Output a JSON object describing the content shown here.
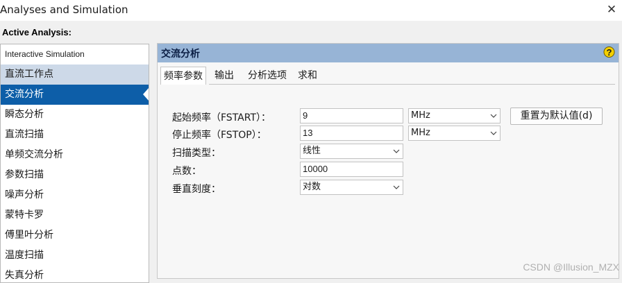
{
  "window": {
    "title": "Analyses and Simulation"
  },
  "active_analysis_label": "Active Analysis:",
  "analysis_list": [
    "Interactive Simulation",
    "直流工作点",
    "交流分析",
    "瞬态分析",
    "直流扫描",
    "单频交流分析",
    "参数扫描",
    "噪声分析",
    "蒙特卡罗",
    "傅里叶分析",
    "温度扫描",
    "失真分析"
  ],
  "selected_analysis": "交流分析",
  "panel": {
    "title": "交流分析",
    "tabs": [
      "频率参数",
      "输出",
      "分析选项",
      "求和"
    ],
    "active_tab": "频率参数"
  },
  "params": {
    "fstart": {
      "label": "起始频率（FSTART）：",
      "value": "9",
      "unit": "MHz"
    },
    "fstop": {
      "label": "停止频率（FSTOP）：",
      "value": "13",
      "unit": "MHz"
    },
    "sweep_type": {
      "label": "扫描类型：",
      "value": "线性"
    },
    "points": {
      "label": "点数：",
      "value": "10000"
    },
    "vertical_scale": {
      "label": "垂直刻度：",
      "value": "对数"
    }
  },
  "reset_button": "重置为默认值(d)",
  "watermark": "CSDN @Illusion_MZX",
  "colors": {
    "selected_bg": "#0d5ea8",
    "highlight_bg": "#cdd9e8",
    "header_bg": "#97b4d6",
    "help_icon": "#f5d000"
  }
}
